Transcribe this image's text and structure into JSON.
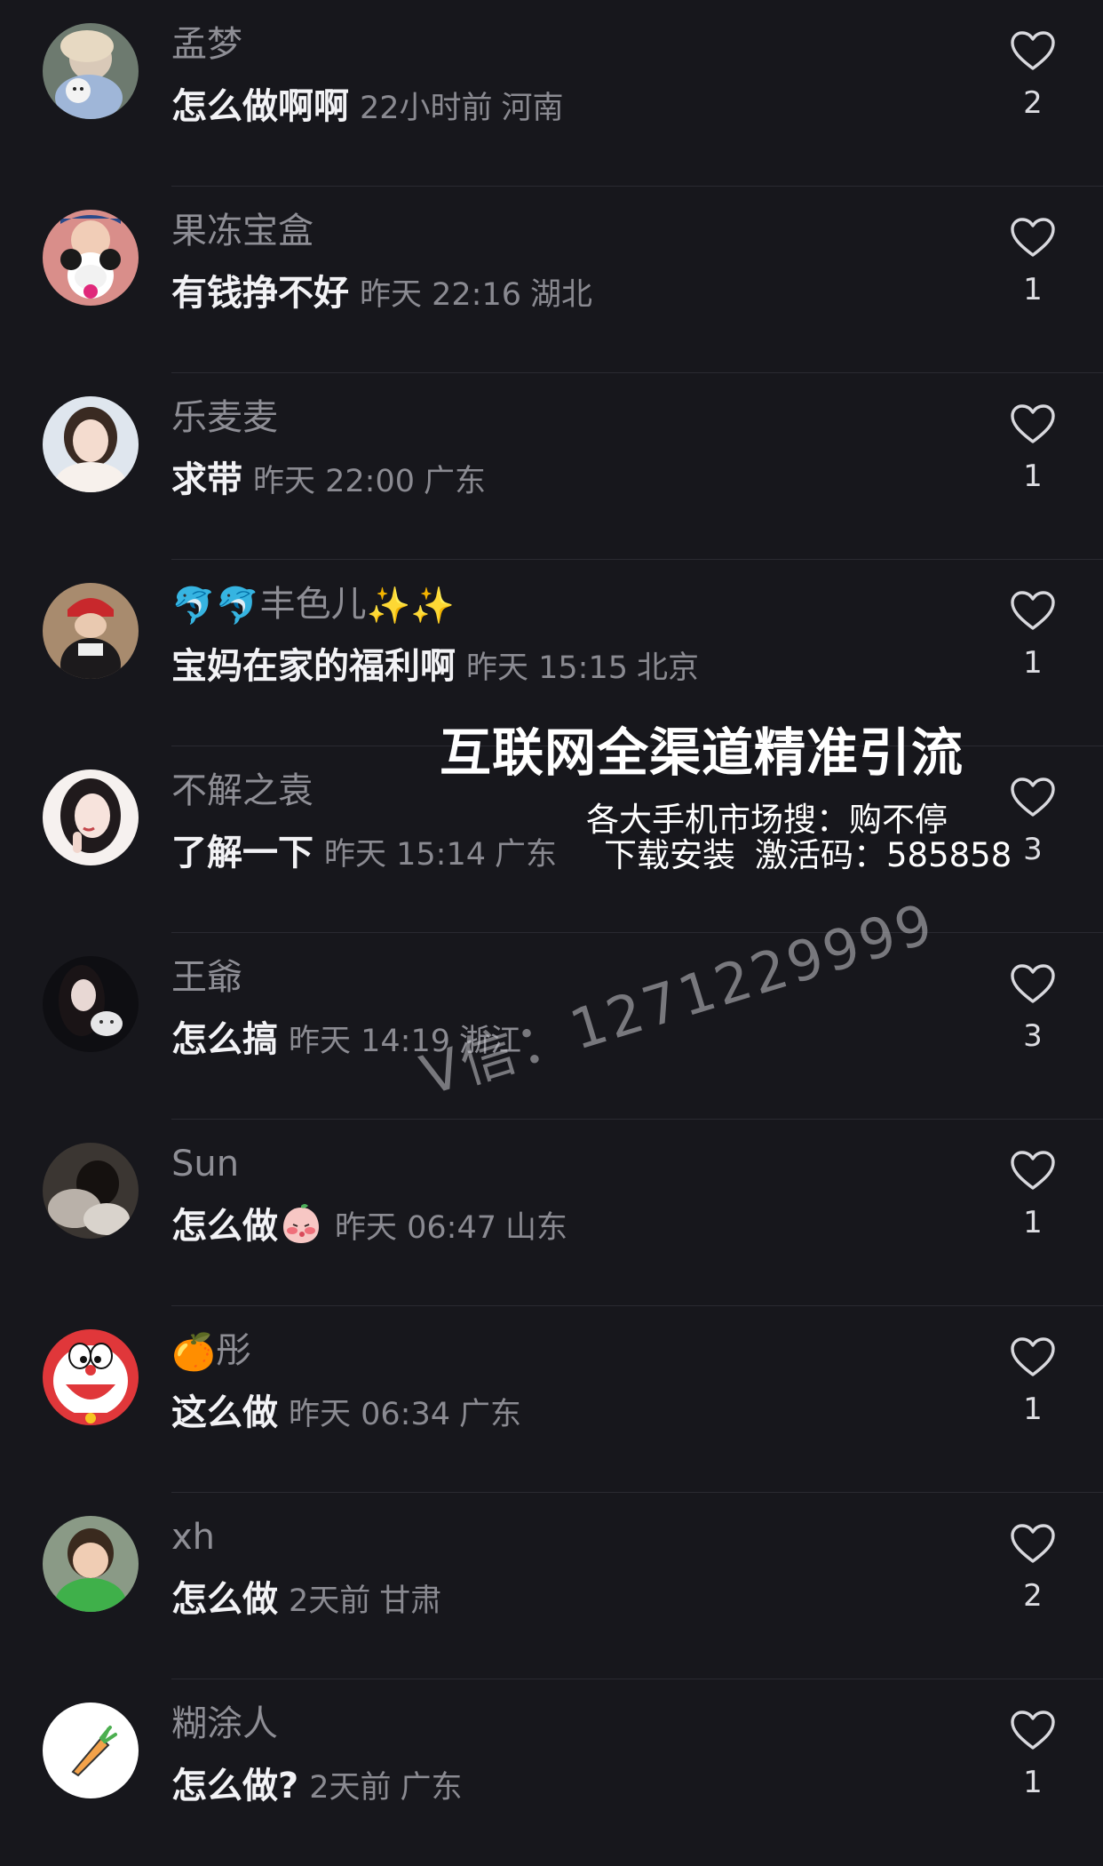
{
  "comments": [
    {
      "username": "孟梦",
      "name_emoji_pre": "",
      "name_emoji_post": "",
      "text": "怎么做啊啊",
      "time": "22小时前",
      "location": "河南",
      "likes": "2",
      "avatar": "girl-with-dog-photo"
    },
    {
      "username": "果冻宝盒",
      "name_emoji_pre": "",
      "name_emoji_post": "",
      "text": "有钱挣不好",
      "time": "昨天 22:16",
      "location": "湖北",
      "likes": "1",
      "avatar": "baby-with-minnie-photo"
    },
    {
      "username": "乐麦麦",
      "name_emoji_pre": "",
      "name_emoji_post": "",
      "text": "求带",
      "time": "昨天 22:00",
      "location": "广东",
      "likes": "1",
      "avatar": "girl-portrait-photo"
    },
    {
      "username": "丰色儿",
      "name_emoji_pre": "🐬🐬",
      "name_emoji_post": "✨✨",
      "text": "宝妈在家的福利啊",
      "time": "昨天 15:15",
      "location": "北京",
      "likes": "1",
      "avatar": "girl-with-cap-photo"
    },
    {
      "username": "不解之袁",
      "name_emoji_pre": "",
      "name_emoji_post": "",
      "text": "了解一下",
      "time": "昨天 15:14",
      "location": "广东",
      "likes": "3",
      "avatar": "illustrated-girl"
    },
    {
      "username": "王爺",
      "name_emoji_pre": "",
      "name_emoji_post": "",
      "text": "怎么搞",
      "time": "昨天 14:19",
      "location": "浙江",
      "likes": "3",
      "avatar": "girl-with-cat-illustration"
    },
    {
      "username": "Sun",
      "name_emoji_pre": "",
      "name_emoji_post": "",
      "text": "怎么做",
      "text_emoji": "blush-peach-emoji",
      "time": "昨天 06:47",
      "location": "山东",
      "likes": "1",
      "avatar": "dark-photo"
    },
    {
      "username": "彤",
      "name_emoji_pre": "🍊",
      "name_emoji_post": "",
      "text": "这么做",
      "time": "昨天 06:34",
      "location": "广东",
      "likes": "1",
      "avatar": "doraemon"
    },
    {
      "username": "xh",
      "name_emoji_pre": "",
      "name_emoji_post": "",
      "text": "怎么做",
      "time": "2天前",
      "location": "甘肃",
      "likes": "2",
      "avatar": "child-green-shirt-photo"
    },
    {
      "username": "糊涂人",
      "name_emoji_pre": "",
      "name_emoji_post": "",
      "text": "怎么做?",
      "time": "2天前",
      "location": "广东",
      "likes": "1",
      "avatar": "carrot-illustration"
    }
  ],
  "overlay": {
    "title": "互联网全渠道精准引流",
    "line1": "各大手机市场搜：购不停",
    "line2_left": "下载安装",
    "line2_right": "激活码：585858",
    "wechat": "V信：1271229999"
  },
  "colors": {
    "background": "#17171c",
    "username": "#8e8e95",
    "text": "#f2f2f5",
    "meta": "#8a8a91",
    "divider": "#2a2a31"
  },
  "icons": {
    "like": "heart-outline-icon"
  }
}
